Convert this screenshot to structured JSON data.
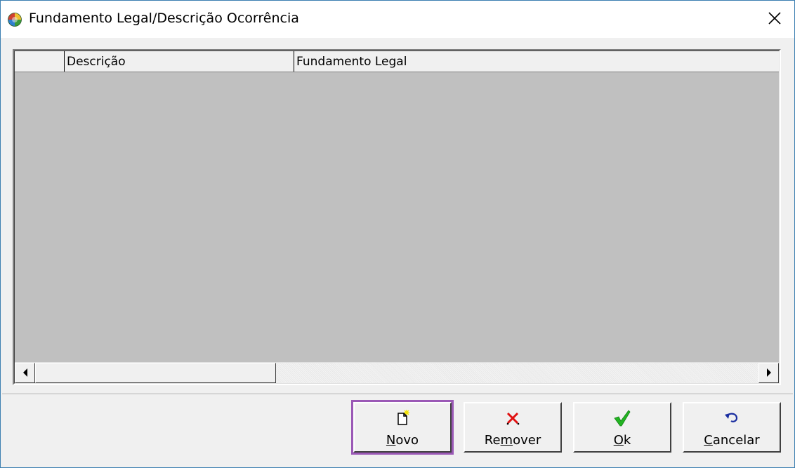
{
  "window": {
    "title": "Fundamento Legal/Descrição Ocorrência",
    "close_glyph": "✕",
    "icon": "app-globe-icon",
    "border_color": "#3c7fb1"
  },
  "grid": {
    "columns": [
      {
        "label": ""
      },
      {
        "label": "Descrição"
      },
      {
        "label": "Fundamento Legal"
      }
    ],
    "rows": [],
    "body_color": "#c0c0c0"
  },
  "buttons": {
    "novo": {
      "prefix": "",
      "accel": "N",
      "suffix": "ovo",
      "icon": "new-document-icon"
    },
    "remover": {
      "prefix": "Re",
      "accel": "m",
      "suffix": "over",
      "icon": "red-x-icon"
    },
    "ok": {
      "prefix": "",
      "accel": "O",
      "suffix": "k",
      "icon": "green-check-icon"
    },
    "cancelar": {
      "prefix": "",
      "accel": "C",
      "suffix": "ancelar",
      "icon": "undo-arrow-icon"
    },
    "focus_color": "#9b59b6"
  }
}
